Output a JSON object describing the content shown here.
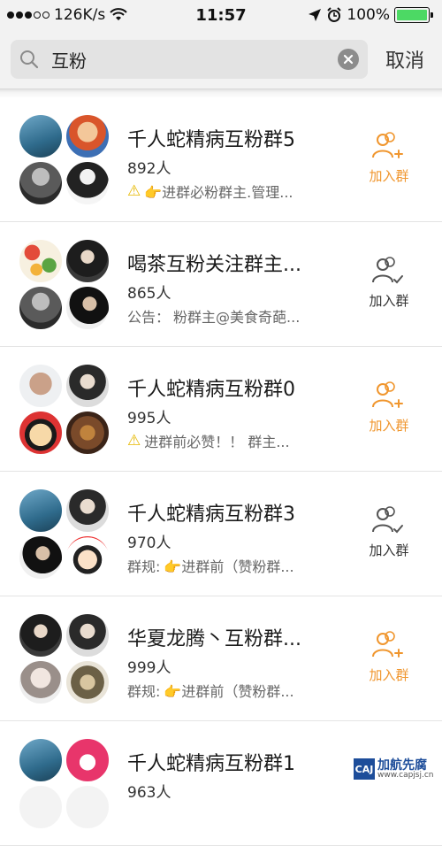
{
  "status_bar": {
    "network_speed": "126K/s",
    "time": "11:57",
    "battery": "100%",
    "battery_level": 1.0,
    "battery_color": "#4cd964"
  },
  "search": {
    "query": "互粉",
    "cancel_label": "取消",
    "icons": [
      "search-icon",
      "clear-icon"
    ]
  },
  "groups": [
    {
      "name": "千人蛇精病互粉群5",
      "members": "892人",
      "notice_prefix": "",
      "notice": "👉进群必粉群主.管理...",
      "warn": true,
      "join_label": "加入群",
      "join_state": "available",
      "avatars": [
        "sky",
        "cartoon",
        "person-gray",
        "person-bw"
      ]
    },
    {
      "name": "喝茶互粉关注群主...",
      "members": "865人",
      "notice_prefix": "公告：",
      "notice": "粉群主@美食奇葩...",
      "warn": false,
      "join_label": "加入群",
      "join_state": "requested",
      "avatars": [
        "food",
        "person-dark",
        "person-gray",
        "person-dark2"
      ]
    },
    {
      "name": "千人蛇精病互粉群0",
      "members": "995人",
      "notice_prefix": "",
      "notice": "进群前必赞！！ 群主...",
      "warn": true,
      "join_label": "加入群",
      "join_state": "available",
      "avatars": [
        "person-back",
        "person-light",
        "cartoon-face",
        "object"
      ]
    },
    {
      "name": "千人蛇精病互粉群3",
      "members": "970人",
      "notice_prefix": "群规:",
      "notice": "👉进群前（赞粉群...",
      "warn": false,
      "join_label": "加入群",
      "join_state": "requested",
      "avatars": [
        "sky",
        "person-light",
        "person-dark2",
        "cartoon-girl"
      ]
    },
    {
      "name": "华夏龙腾丶互粉群...",
      "members": "999人",
      "notice_prefix": "群规:",
      "notice": "👉进群前（赞粉群...",
      "warn": false,
      "join_label": "加入群",
      "join_state": "available",
      "avatars": [
        "person-dark",
        "person-light",
        "person-pale",
        "object2"
      ]
    },
    {
      "name": "千人蛇精病互粉群1",
      "members": "963人",
      "notice_prefix": "",
      "notice": "",
      "warn": false,
      "join_label": "",
      "join_state": "none",
      "avatars": [
        "sky",
        "cartoon-pink",
        "",
        ""
      ]
    }
  ],
  "colors": {
    "accent_orange": "#f0962e",
    "text_dark": "#1a1a1a",
    "header_bg": "#f2f2f2"
  },
  "watermark": {
    "title": "加航先腐",
    "url": "www.capjsj.cn",
    "logo": "CAJ"
  }
}
